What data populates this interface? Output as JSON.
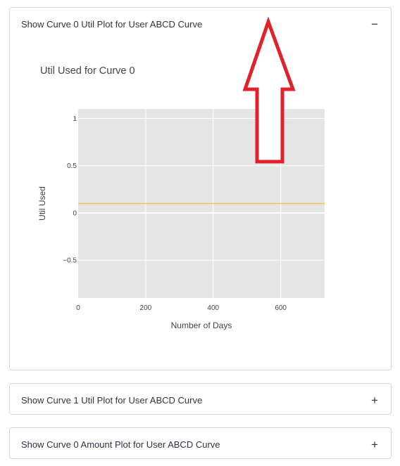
{
  "expanders": [
    {
      "label": "Show Curve 0 Util Plot for User ABCD Curve",
      "icon": "−",
      "expanded": true
    },
    {
      "label": "Show Curve 1 Util Plot for User ABCD Curve",
      "icon": "+",
      "expanded": false
    },
    {
      "label": "Show Curve 0 Amount Plot for User ABCD Curve",
      "icon": "+",
      "expanded": false
    }
  ],
  "annotation": {
    "type": "arrow",
    "direction": "up",
    "color": "#e0222b"
  },
  "chart_data": {
    "type": "line",
    "title": "Util Used for Curve 0",
    "xlabel": "Number of Days",
    "ylabel": "Util Used",
    "xlim": [
      0,
      730
    ],
    "ylim": [
      -0.9,
      1.1
    ],
    "x_ticks": [
      0,
      200,
      400,
      600
    ],
    "x_tick_labels": [
      "0",
      "200",
      "400",
      "600"
    ],
    "y_ticks": [
      1,
      0.5,
      0,
      -0.5
    ],
    "y_tick_labels": [
      "1",
      "0.5",
      "0",
      "−0.5"
    ],
    "grid": true,
    "background": "#e5e5e5",
    "series": [
      {
        "color": "#f5c14f",
        "x": [
          0,
          730
        ],
        "y": [
          0.1,
          0.1
        ]
      }
    ]
  }
}
